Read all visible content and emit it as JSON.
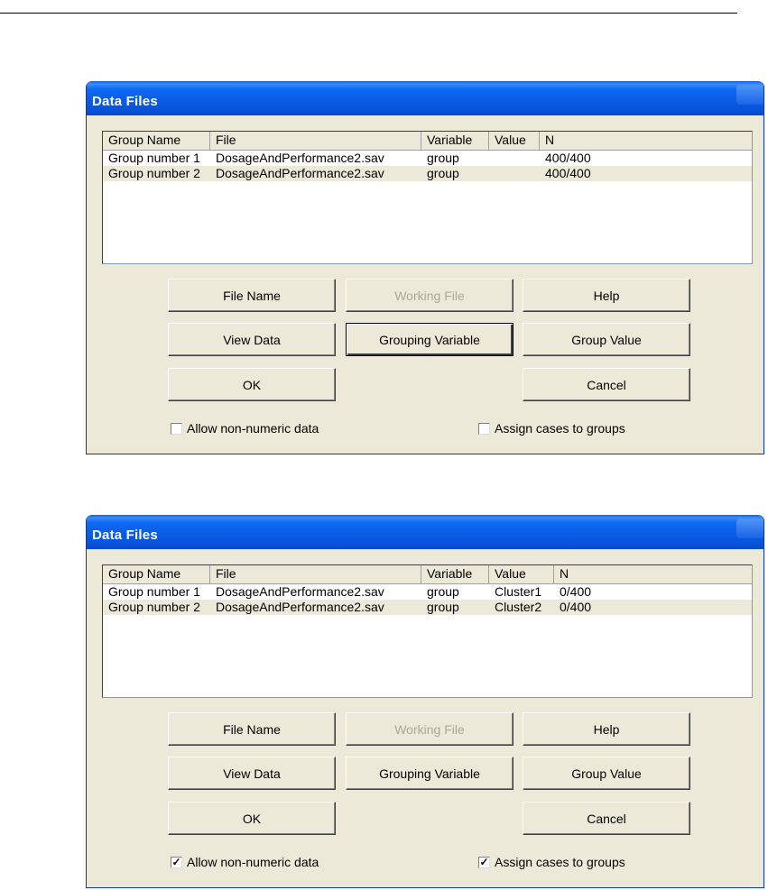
{
  "dialogs": [
    {
      "title": "Data Files",
      "columns": [
        "Group Name",
        "File",
        "Variable",
        "Value",
        "N"
      ],
      "rows": [
        [
          "Group number 1",
          "DosageAndPerformance2.sav",
          "group",
          "",
          "400/400"
        ],
        [
          "Group number 2",
          "DosageAndPerformance2.sav",
          "group",
          "",
          "400/400"
        ]
      ],
      "buttons": {
        "file_name": "File Name",
        "working_file": "Working File",
        "help": "Help",
        "view_data": "View Data",
        "grouping_variable": "Grouping Variable",
        "group_value": "Group Value",
        "ok": "OK",
        "cancel": "Cancel"
      },
      "allow_non_numeric": {
        "label": "Allow non-numeric data",
        "checked": false
      },
      "assign_cases": {
        "label": "Assign cases to groups",
        "checked": false
      }
    },
    {
      "title": "Data Files",
      "columns": [
        "Group Name",
        "File",
        "Variable",
        "Value",
        "N"
      ],
      "rows": [
        [
          "Group number 1",
          "DosageAndPerformance2.sav",
          "group",
          "Cluster1",
          "0/400"
        ],
        [
          "Group number 2",
          "DosageAndPerformance2.sav",
          "group",
          "Cluster2",
          "0/400"
        ]
      ],
      "buttons": {
        "file_name": "File Name",
        "working_file": "Working File",
        "help": "Help",
        "view_data": "View Data",
        "grouping_variable": "Grouping Variable",
        "group_value": "Group Value",
        "ok": "OK",
        "cancel": "Cancel"
      },
      "allow_non_numeric": {
        "label": "Allow non-numeric data",
        "checked": true
      },
      "assign_cases": {
        "label": "Assign cases to groups",
        "checked": true
      }
    }
  ],
  "colors": {
    "titlebar": "#0a5ce6",
    "dialog_bg": "#ece9d8",
    "disabled_text": "#aca899"
  }
}
